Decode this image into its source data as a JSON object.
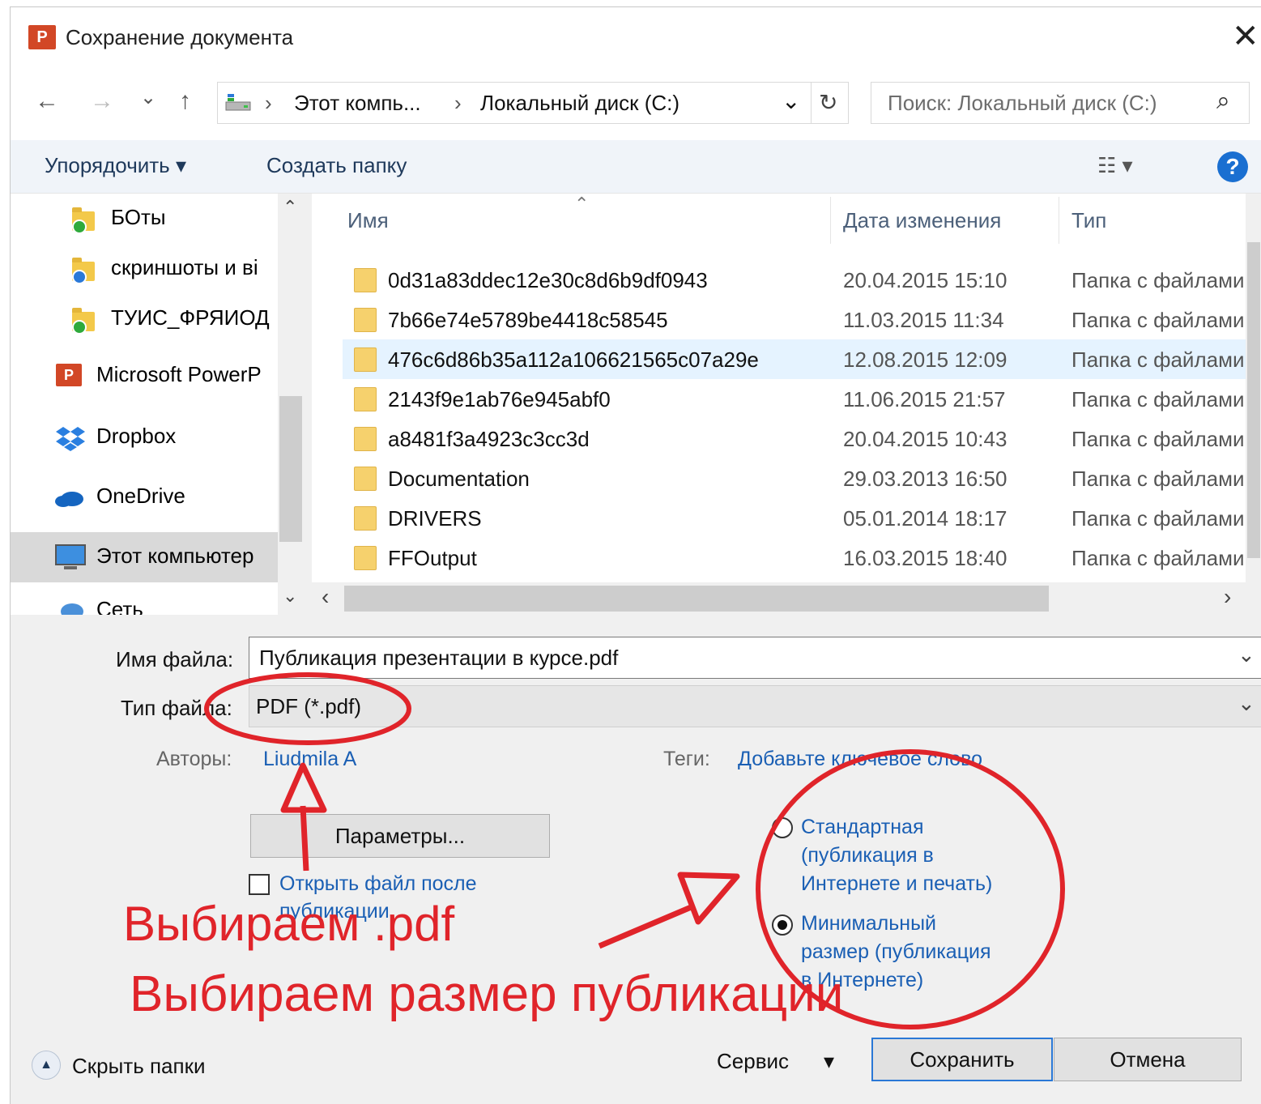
{
  "window": {
    "title": "Сохранение документа",
    "app_badge": "P"
  },
  "nav": {
    "back_glyph": "←",
    "forward_glyph": "→",
    "history_glyph": "⌄",
    "up_glyph": "↑",
    "breadcrumb": [
      "Этот компь...",
      "Локальный диск (C:)"
    ],
    "breadcrumb_separator": "›",
    "refresh_glyph": "↻",
    "search_placeholder": "Поиск: Локальный диск (C:)",
    "search_glyph": "⌕"
  },
  "toolbar": {
    "organize_label": "Упорядочить ▾",
    "new_folder_label": "Создать папку",
    "view_glyph": "☷ ▾",
    "help_label": "?"
  },
  "sidebar": {
    "items": [
      {
        "label": "БОты",
        "badge_color": "#2faa3c"
      },
      {
        "label": "скриншоты и ві",
        "badge_color": "#2b79d8"
      },
      {
        "label": "ТУИС_ФРЯИОД",
        "badge_color": "#2faa3c"
      },
      {
        "label": "Microsoft PowerP",
        "icon": "powerpoint-icon"
      },
      {
        "label": "Dropbox",
        "icon": "dropbox-icon"
      },
      {
        "label": "OneDrive",
        "icon": "onedrive-icon"
      },
      {
        "label": "Этот компьютер",
        "icon": "computer-icon",
        "selected": true
      },
      {
        "label": "Сеть",
        "icon": "network-icon"
      }
    ],
    "scroll_up_glyph": "⌃",
    "scroll_down_glyph": "⌄"
  },
  "files": {
    "columns": [
      "Имя",
      "Дата изменения",
      "Тип"
    ],
    "sort_glyph": "⌃",
    "rows": [
      {
        "name": "0d31a83ddec12e30c8d6b9df0943",
        "date": "20.04.2015 15:10",
        "type": "Папка с файлами"
      },
      {
        "name": "7b66e74e5789be4418c58545",
        "date": "11.03.2015 11:34",
        "type": "Папка с файлами"
      },
      {
        "name": "476c6d86b35a112a106621565c07a29e",
        "date": "12.08.2015 12:09",
        "type": "Папка с файлами",
        "selected": true
      },
      {
        "name": "2143f9e1ab76e945abf0",
        "date": "11.06.2015 21:57",
        "type": "Папка с файлами"
      },
      {
        "name": "a8481f3a4923c3cc3d",
        "date": "20.04.2015 10:43",
        "type": "Папка с файлами"
      },
      {
        "name": "Documentation",
        "date": "29.03.2013 16:50",
        "type": "Папка с файлами"
      },
      {
        "name": "DRIVERS",
        "date": "05.01.2014 18:17",
        "type": "Папка с файлами"
      },
      {
        "name": "FFOutput",
        "date": "16.03.2015 18:40",
        "type": "Папка с файлами"
      }
    ],
    "hscroll_left_glyph": "‹",
    "hscroll_right_glyph": "›"
  },
  "form": {
    "filename_label": "Имя файла:",
    "filename_value": "Публикация презентации в курсе.pdf",
    "filetype_label": "Тип файла:",
    "filetype_value": "PDF (*.pdf)",
    "dropdown_glyph": "⌄",
    "authors_label": "Авторы:",
    "authors_value": "Liudmila A",
    "tags_label": "Теги:",
    "tags_placeholder": "Добавьте ключевое слово",
    "options_button": "Параметры...",
    "open_after_label": [
      "Открыть файл после",
      "публикации"
    ],
    "optimize": {
      "standard": {
        "lines": [
          "Стандартная",
          "(публикация в",
          "Интернете и печать)"
        ],
        "checked": false
      },
      "minimum": {
        "lines": [
          "Минимальный",
          "размер (публикация",
          "в Интернете)"
        ],
        "checked": true
      }
    }
  },
  "footer": {
    "hide_folders_label": "Скрыть папки",
    "hide_folders_glyph": "▲",
    "tools_label": "Сервис",
    "tools_glyph": "▾",
    "save_label": "Сохранить",
    "cancel_label": "Отмена"
  },
  "annotations": {
    "color": "#e0242a",
    "text_pdf": "Выбираем .pdf",
    "text_size": "Выбираем размер публикации"
  }
}
